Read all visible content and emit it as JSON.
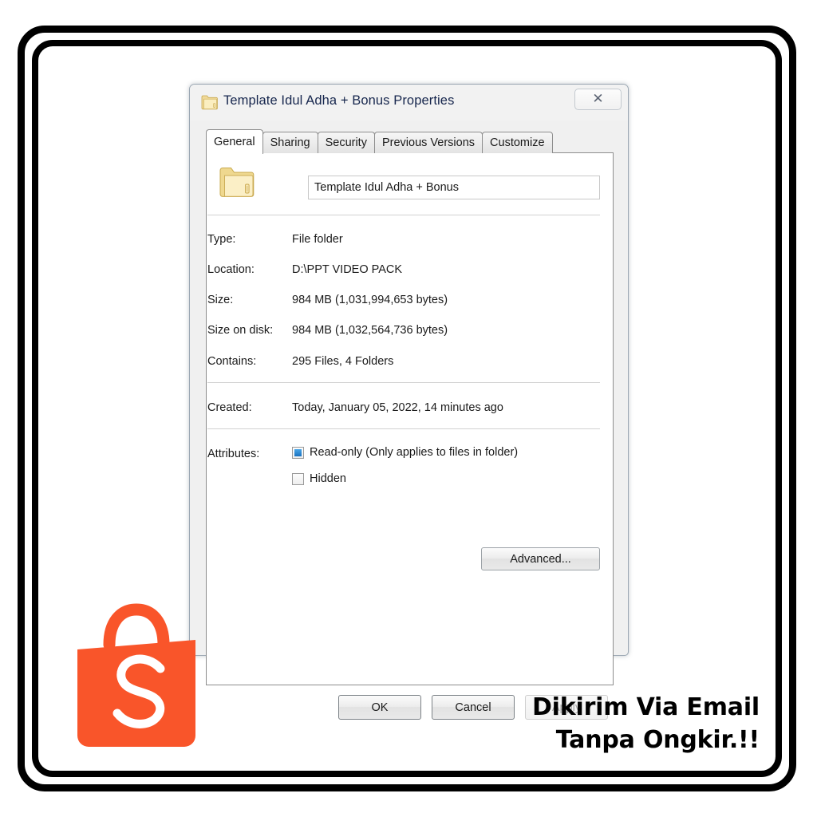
{
  "frame": {
    "border_color": "#000000",
    "background": "#ffffff"
  },
  "dialog": {
    "title": "Template Idul Adha + Bonus Properties",
    "title_icon": "folder-icon",
    "close_button": {
      "icon": "close-icon",
      "glyph": "✕"
    },
    "tabs": [
      {
        "label": "General",
        "active": true
      },
      {
        "label": "Sharing",
        "active": false
      },
      {
        "label": "Security",
        "active": false
      },
      {
        "label": "Previous Versions",
        "active": false
      },
      {
        "label": "Customize",
        "active": false
      }
    ],
    "general": {
      "folder_icon": "folder-icon",
      "name_value": "Template Idul Adha + Bonus",
      "rows": [
        {
          "key": "Type:",
          "value": "File folder"
        },
        {
          "key": "Location:",
          "value": "D:\\PPT VIDEO PACK"
        },
        {
          "key": "Size:",
          "value": "984 MB (1,031,994,653 bytes)"
        },
        {
          "key": "Size on disk:",
          "value": "984 MB (1,032,564,736 bytes)"
        },
        {
          "key": "Contains:",
          "value": "295 Files, 4 Folders"
        }
      ],
      "created": {
        "key": "Created:",
        "value": "Today, January 05, 2022, 14 minutes ago"
      },
      "attributes": {
        "label": "Attributes:",
        "readonly": {
          "label": "Read-only (Only applies to files in folder)",
          "state": "mixed",
          "fill_color": "#1a72c0"
        },
        "hidden": {
          "label": "Hidden",
          "state": "unchecked"
        },
        "advanced_button": "Advanced..."
      }
    },
    "footer": {
      "ok": "OK",
      "cancel": "Cancel",
      "apply": "Apply",
      "apply_disabled": true
    }
  },
  "branding": {
    "logo_name": "shopee-bag-logo",
    "logo_color": "#F9552A",
    "logo_letter": "S",
    "promo_line1": "Dikirim Via Email",
    "promo_line2": "Tanpa Ongkir.!!"
  }
}
